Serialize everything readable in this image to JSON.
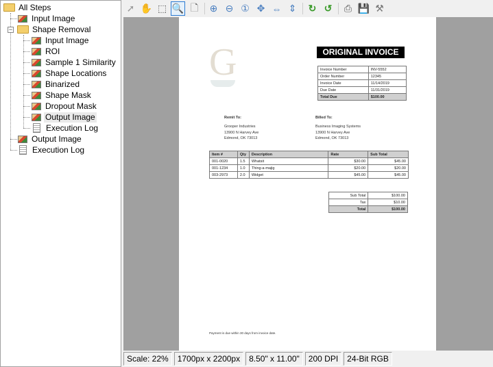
{
  "tree": {
    "root": "All Steps",
    "items": [
      {
        "label": "Input Image",
        "type": "image"
      },
      {
        "label": "Shape Removal",
        "type": "folder",
        "children": [
          {
            "label": "Input Image",
            "type": "image"
          },
          {
            "label": "ROI",
            "type": "image"
          },
          {
            "label": "Sample 1 Similarity",
            "type": "image"
          },
          {
            "label": "Shape Locations",
            "type": "image"
          },
          {
            "label": "Binarized",
            "type": "image"
          },
          {
            "label": "Shape Mask",
            "type": "image"
          },
          {
            "label": "Dropout Mask",
            "type": "image"
          },
          {
            "label": "Output Image",
            "type": "image",
            "selected": true
          },
          {
            "label": "Execution Log",
            "type": "doc"
          }
        ]
      },
      {
        "label": "Output Image",
        "type": "image"
      },
      {
        "label": "Execution Log",
        "type": "doc"
      }
    ]
  },
  "toolbar": [
    "select-pointer",
    "pan-hand",
    "select-region",
    "zoom-region",
    "zoom-page",
    "zoom-in",
    "zoom-out",
    "zoom-actual",
    "zoom-fit",
    "fit-width",
    "fit-height",
    "rotate-right",
    "rotate-left",
    "print",
    "save",
    "tools"
  ],
  "invoice": {
    "title": "ORIGINAL INVOICE",
    "info": [
      [
        "Invoice Number",
        "INV-5552"
      ],
      [
        "Order Number",
        "12345"
      ],
      [
        "Invoice Date",
        "11/14/2019"
      ],
      [
        "Due Date",
        "11/31/2019"
      ],
      [
        "Total Due",
        "$100.00"
      ]
    ],
    "remit_label": "Remit To:",
    "remit": [
      "Grooper Industries",
      "13900 N Harvey Ave",
      "Edmond, OK 73013"
    ],
    "billed_label": "Billed To:",
    "billed": [
      "Business Imaging Systems",
      "13900 N Harvey Ave",
      "Edmond, OK 73013"
    ],
    "headers": [
      "Item #",
      "Qty",
      "Description",
      "Rate",
      "Sub Total"
    ],
    "rows": [
      [
        "001-0020",
        "1.5",
        "Whatsit",
        "$30.00",
        "$45.00"
      ],
      [
        "001-1234",
        "1.0",
        "Thing-a-majig",
        "$20.00",
        "$20.00"
      ],
      [
        "003-2973",
        "2.0",
        "Widget",
        "$45.00",
        "$45.00"
      ]
    ],
    "totals": [
      [
        "Sub Total",
        "$100.00"
      ],
      [
        "Tax",
        "$10.00"
      ],
      [
        "Total",
        "$100.00"
      ]
    ],
    "footer": "Payment is due within 30 days from invoice date.",
    "logo_letter": "G"
  },
  "status": {
    "scale": "Scale: 22%",
    "pixels": "1700px x 2200px",
    "size": "8.50\" x 11.00\"",
    "dpi": "200 DPI",
    "depth": "24-Bit RGB"
  }
}
